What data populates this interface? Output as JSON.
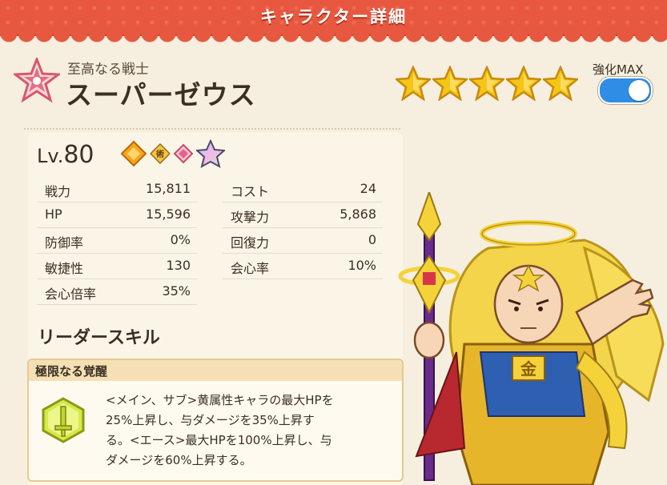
{
  "header": {
    "title": "キャラクター詳細"
  },
  "character": {
    "subtitle": "至高なる戦士",
    "name": "スーパーゼウス",
    "rarity_stars": 5,
    "max_label": "強化MAX",
    "toggle_on": true,
    "level_prefix": "Lv.",
    "level": "80",
    "badges": [
      "attribute-icon",
      "skill-type-icon",
      "gem-icon",
      "rainbow-star-icon"
    ],
    "badge_text": "術"
  },
  "stats": {
    "left": [
      {
        "label": "戦力",
        "value": "15,811"
      },
      {
        "label": "HP",
        "value": "15,596"
      },
      {
        "label": "防御率",
        "value": "0%"
      },
      {
        "label": "敏捷性",
        "value": "130"
      },
      {
        "label": "会心倍率",
        "value": "35%"
      }
    ],
    "right": [
      {
        "label": "コスト",
        "value": "24"
      },
      {
        "label": "攻撃力",
        "value": "5,868"
      },
      {
        "label": "回復力",
        "value": "0"
      },
      {
        "label": "会心率",
        "value": "10%"
      }
    ]
  },
  "leader_skill": {
    "title": "リーダースキル",
    "name": "極限なる覚醒",
    "description": "<メイン、サブ>黄属性キャラの最大HPを\n25%上昇し、与ダメージを35%上昇す\nる。<エース>最大HPを100%上昇し、与\nダメージを60%上昇する。"
  },
  "colors": {
    "header_red": "#e8573f",
    "background": "#f6efdf",
    "toggle_blue": "#2f8de6",
    "star_gold": "#f5c518"
  }
}
